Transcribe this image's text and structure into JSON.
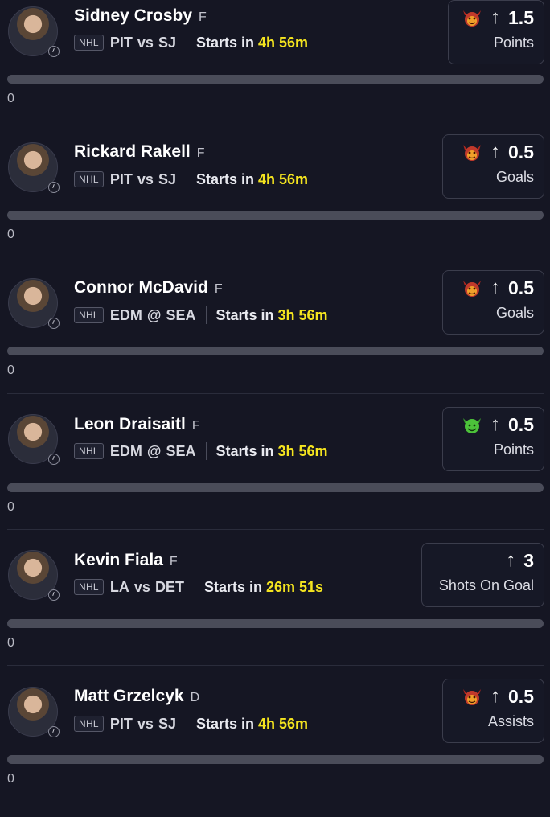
{
  "players": [
    {
      "name": "Sidney Crosby",
      "position": "F",
      "league": "NHL",
      "team": "PIT",
      "opp_sep": "vs",
      "opponent": "SJ",
      "starts_label": "Starts in",
      "countdown": "4h 56m",
      "direction_icon": "arrow-up-icon",
      "line": "1.5",
      "stat": "Points",
      "badge_icon": "red-demon-icon",
      "progress": 0,
      "progress_label": "0"
    },
    {
      "name": "Rickard Rakell",
      "position": "F",
      "league": "NHL",
      "team": "PIT",
      "opp_sep": "vs",
      "opponent": "SJ",
      "starts_label": "Starts in",
      "countdown": "4h 56m",
      "direction_icon": "arrow-up-icon",
      "line": "0.5",
      "stat": "Goals",
      "badge_icon": "red-demon-icon",
      "progress": 0,
      "progress_label": "0"
    },
    {
      "name": "Connor McDavid",
      "position": "F",
      "league": "NHL",
      "team": "EDM",
      "opp_sep": "@",
      "opponent": "SEA",
      "starts_label": "Starts in",
      "countdown": "3h 56m",
      "direction_icon": "arrow-up-icon",
      "line": "0.5",
      "stat": "Goals",
      "badge_icon": "red-demon-icon",
      "progress": 0,
      "progress_label": "0"
    },
    {
      "name": "Leon Draisaitl",
      "position": "F",
      "league": "NHL",
      "team": "EDM",
      "opp_sep": "@",
      "opponent": "SEA",
      "starts_label": "Starts in",
      "countdown": "3h 56m",
      "direction_icon": "arrow-up-icon",
      "line": "0.5",
      "stat": "Points",
      "badge_icon": "green-goblin-icon",
      "progress": 0,
      "progress_label": "0"
    },
    {
      "name": "Kevin Fiala",
      "position": "F",
      "league": "NHL",
      "team": "LA",
      "opp_sep": "vs",
      "opponent": "DET",
      "starts_label": "Starts in",
      "countdown": "26m 51s",
      "direction_icon": "arrow-up-icon",
      "line": "3",
      "stat": "Shots On Goal",
      "badge_icon": "",
      "progress": 0,
      "progress_label": "0"
    },
    {
      "name": "Matt Grzelcyk",
      "position": "D",
      "league": "NHL",
      "team": "PIT",
      "opp_sep": "vs",
      "opponent": "SJ",
      "starts_label": "Starts in",
      "countdown": "4h 56m",
      "direction_icon": "arrow-up-icon",
      "line": "0.5",
      "stat": "Assists",
      "badge_icon": "red-demon-icon",
      "progress": 0,
      "progress_label": "0"
    }
  ],
  "colors": {
    "background": "#151623",
    "countdown": "#f4e41f",
    "red_demon": "#b3261e",
    "green_goblin": "#4cc23a",
    "track": "#4a4c59"
  }
}
